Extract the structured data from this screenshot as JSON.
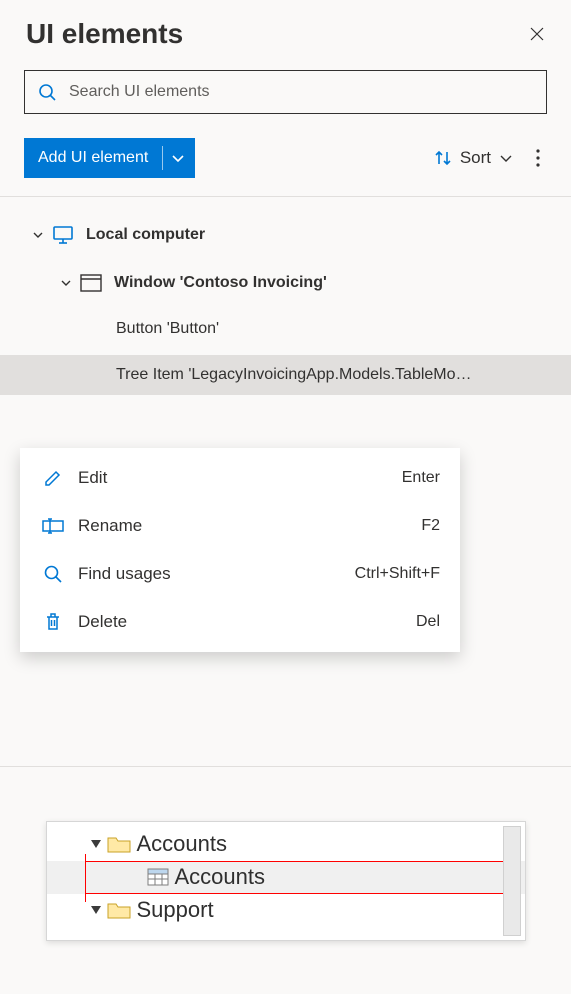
{
  "header": {
    "title": "UI elements"
  },
  "search": {
    "placeholder": "Search UI elements"
  },
  "toolbar": {
    "add_label": "Add UI element",
    "sort_label": "Sort"
  },
  "tree": {
    "root": {
      "label": "Local computer",
      "children": [
        {
          "label": "Window 'Contoso Invoicing'",
          "children": [
            {
              "label": "Button 'Button'",
              "selected": false
            },
            {
              "label": "Tree Item 'LegacyInvoicingApp.Models.TableMo…",
              "selected": true
            }
          ]
        }
      ]
    }
  },
  "context_menu": {
    "items": [
      {
        "label": "Edit",
        "shortcut": "Enter",
        "icon": "pencil-icon"
      },
      {
        "label": "Rename",
        "shortcut": "F2",
        "icon": "rename-icon"
      },
      {
        "label": "Find usages",
        "shortcut": "Ctrl+Shift+F",
        "icon": "search-icon"
      },
      {
        "label": "Delete",
        "shortcut": "Del",
        "icon": "trash-icon"
      }
    ]
  },
  "preview": {
    "rows": [
      {
        "label": "Accounts",
        "type": "folder",
        "indent": 0
      },
      {
        "label": "Accounts",
        "type": "table",
        "indent": 1,
        "highlighted": true
      },
      {
        "label": "Support",
        "type": "folder",
        "indent": 0
      }
    ]
  }
}
